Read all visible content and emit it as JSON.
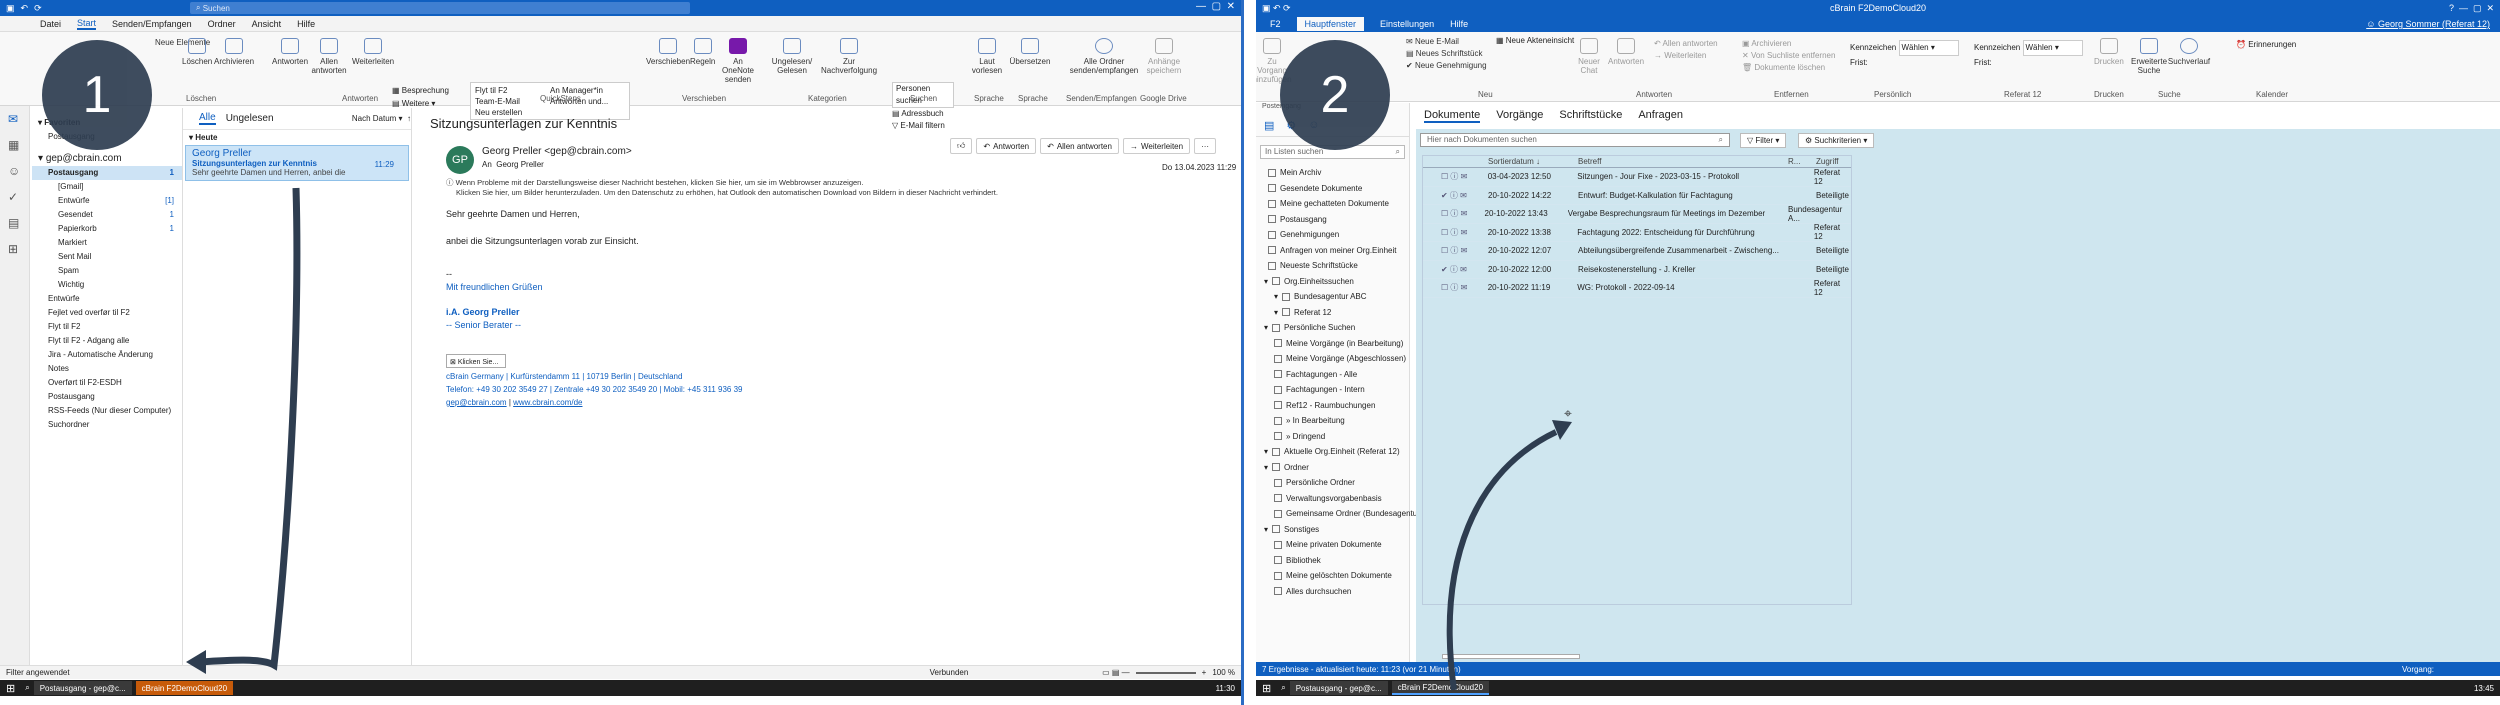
{
  "left": {
    "search_placeholder": "Suchen",
    "tabs": [
      "Datei",
      "Start",
      "Senden/Empfangen",
      "Ordner",
      "Ansicht",
      "Hilfe"
    ],
    "active_tab": "Start",
    "ribbon": {
      "new_buttons": [
        "Neue E-Mail",
        "Neue Elemente"
      ],
      "delete_group": {
        "label": "Löschen",
        "buttons": [
          "Löschen",
          "Archivieren"
        ]
      },
      "respond_group": {
        "label": "Antworten",
        "buttons": [
          "Antworten",
          "Allen antworten",
          "Weiterleiten"
        ],
        "small": [
          "Besprechung",
          "Weitere"
        ]
      },
      "quicksteps": {
        "label": "QuickSteps",
        "items": [
          "Flyt til F2",
          "Team-E-Mail",
          "Neu erstellen",
          "An Manager*in",
          "Antworten und..."
        ]
      },
      "move_group": {
        "label": "Verschieben",
        "buttons": [
          "Verschieben",
          "Regeln",
          "An OneNote senden"
        ]
      },
      "tags_group": {
        "label": "Kategorien",
        "buttons": [
          "Ungelesen/ Gelesen",
          "Zur Nachverfolgung"
        ]
      },
      "find_group": {
        "label": "Suchen",
        "items": [
          "Personen suchen",
          "Adressbuch",
          "E-Mail filtern"
        ]
      },
      "speech": {
        "label": "Sprache",
        "button": "Laut vorlesen"
      },
      "lang": {
        "label": "Sprache",
        "button": "Übersetzen"
      },
      "sendrecv": {
        "label": "Senden/Empfangen",
        "button": "Alle Ordner senden/empfangen"
      },
      "gdrive": {
        "label": "Google Drive",
        "button": "Anhänge speichern"
      }
    },
    "folders": {
      "favorites": [
        "Favoriten",
        "Postausgang"
      ],
      "account": "gep@cbrain.com",
      "items": [
        {
          "name": "Postausgang",
          "count": "1",
          "bold": true
        },
        {
          "name": "[Gmail]",
          "count": ""
        },
        {
          "name": "Entwürfe",
          "count": "[1]"
        },
        {
          "name": "Gesendet",
          "count": "1"
        },
        {
          "name": "Papierkorb",
          "count": "1"
        },
        {
          "name": "Markiert",
          "count": ""
        },
        {
          "name": "Sent Mail",
          "count": ""
        },
        {
          "name": "Spam",
          "count": ""
        },
        {
          "name": "Wichtig",
          "count": ""
        },
        {
          "name": "Entwürfe",
          "count": ""
        },
        {
          "name": "Fejlet ved overfør til F2",
          "count": ""
        },
        {
          "name": "Flyt til F2",
          "count": ""
        },
        {
          "name": "Flyt til F2 - Adgang alle",
          "count": ""
        },
        {
          "name": "Jira - Automatische Änderung",
          "count": ""
        },
        {
          "name": "Notes",
          "count": ""
        },
        {
          "name": "Overført til F2-ESDH",
          "count": ""
        },
        {
          "name": "Postausgang",
          "count": ""
        },
        {
          "name": "RSS-Feeds (Nur dieser Computer)",
          "count": ""
        },
        {
          "name": "Suchordner",
          "count": ""
        }
      ]
    },
    "list": {
      "filters": [
        "Alle",
        "Ungelesen"
      ],
      "sort": "Nach Datum",
      "group": "Heute",
      "mail": {
        "sender": "Georg Preller",
        "subject": "Sitzungsunterlagen zur Kenntnis",
        "preview": "Sehr geehrte Damen und Herren,  anbei die",
        "time": "11:29"
      }
    },
    "reading": {
      "title": "Sitzungsunterlagen zur Kenntnis",
      "avatar": "GP",
      "from": "Georg Preller <gep@cbrain.com>",
      "to": "Georg Preller",
      "to_label": "An",
      "date": "Do 13.04.2023 11:29",
      "actions": [
        "Antworten",
        "Allen antworten",
        "Weiterleiten"
      ],
      "info1": "Wenn Probleme mit der Darstellungsweise dieser Nachricht bestehen, klicken Sie hier, um sie im Webbrowser anzuzeigen.",
      "info2": "Klicken Sie hier, um Bilder herunterzuladen. Um den Datenschutz zu erhöhen, hat Outlook den automatischen Download von Bildern in dieser Nachricht verhindert.",
      "body1": "Sehr geehrte Damen und Herren,",
      "body2": "anbei die Sitzungsunterlagen vorab zur Einsicht.",
      "sig_dash": "--",
      "sig_greet": "Mit freundlichen Grüßen",
      "sig_name": "i.A. Georg Preller",
      "sig_role": "-- Senior Berater --",
      "img_alt": "Klicken Sie...",
      "addr1": "cBrain Germany | Kurfürstendamm 11 | 10719 Berlin | Deutschland",
      "addr2": "Telefon: +49 30 202 3549 27 | Zentrale +49 30 202 3549 20 | Mobil: +45 311 936 39",
      "addr3a": "gep@cbrain.com",
      "addr3b": "www.cbrain.com/de"
    },
    "status_left": "Filter angewendet",
    "status_mid": "Verbunden",
    "zoom": "100 %",
    "badge": "1",
    "taskbar": [
      "Postausgang - gep@c...",
      "cBrain F2DemoCloud20"
    ],
    "clock": "11:30"
  },
  "right": {
    "title": "cBrain F2DemoCloud20",
    "tabs": [
      "F2",
      "Hauptfenster",
      "Einstellungen",
      "Hilfe"
    ],
    "active_tab": "Hauptfenster",
    "user": "Georg Sommer (Referat 12)",
    "ribbon": {
      "new_items": [
        "Neue E-Mail",
        "Neues Schriftstück",
        "Neue Genehmigung",
        "Neue Akteneinsicht"
      ],
      "groups": [
        "Neu",
        "Antworten",
        "Entfernen",
        "Persönlich",
        "Referat 12",
        "Drucken",
        "Suche",
        "Kalender"
      ],
      "respond": [
        "Neuer Chat",
        "Antworten",
        "Allen antworten",
        "Weiterleiten"
      ],
      "remove": [
        "Archivieren",
        "Von Suchliste entfernen",
        "Dokumente löschen"
      ],
      "kennz1": "Kennzeichen",
      "kennz1v": "Wählen",
      "frist1": "Frist:",
      "kennz2": "Kennzeichen",
      "kennz2v": "Wählen",
      "frist2": "Frist:",
      "print": "Drucken",
      "search": [
        "Erweiterte Suche",
        "Suchverlauf"
      ],
      "calendar": "Erinnerungen",
      "left_btn": "Zu Vorgang hinzufügen"
    },
    "nav_search": "In Listen suchen",
    "nav_tab": "Posteingang",
    "nav": {
      "items1": [
        "Mein Archiv",
        "Gesendete Dokumente",
        "Meine gechatteten Dokumente",
        "Postausgang",
        "Genehmigungen",
        "Anfragen von meiner Org.Einheit",
        "Neueste Schriftstücke"
      ],
      "org_title": "Org.Einheitssuchen",
      "org": [
        "Bundesagentur ABC",
        "Referat 12"
      ],
      "personal_title": "Persönliche Suchen",
      "personal": [
        "Meine Vorgänge (in Bearbeitung)",
        "Meine Vorgänge (Abgeschlossen)",
        "Fachtagungen - Alle",
        "Fachtagungen - Intern",
        "Ref12 - Raumbuchungen",
        "» In Bearbeitung",
        "» Dringend"
      ],
      "current": "Aktuelle Org.Einheit (Referat 12)",
      "folders_title": "Ordner",
      "folders": [
        "Persönliche Ordner",
        "Verwaltungsvorgabenbasis",
        "Gemeinsame Ordner (Bundesagentur)"
      ],
      "other_title": "Sonstiges",
      "other": [
        "Meine privaten Dokumente",
        "Bibliothek",
        "Meine gelöschten Dokumente",
        "Alles durchsuchen"
      ]
    },
    "content_tabs": [
      "Dokumente",
      "Vorgänge",
      "Schriftstücke",
      "Anfragen"
    ],
    "search_placeholder": "Hier nach Dokumenten suchen",
    "filter": "Filter",
    "criteria": "Suchkriterien",
    "columns": [
      "Sortierdatum",
      "Betreff",
      "R...",
      "Zugriff"
    ],
    "rows": [
      {
        "date": "03-04-2023 12:50",
        "subject": "Sitzungen - Jour Fixe - 2023-03-15 - Protokoll",
        "access": "Referat 12"
      },
      {
        "date": "20-10-2022 14:22",
        "subject": "Entwurf: Budget-Kalkulation für Fachtagung",
        "access": "Beteiligte"
      },
      {
        "date": "20-10-2022 13:43",
        "subject": "Vergabe Besprechungsraum für Meetings im Dezember",
        "access": "Bundesagentur A..."
      },
      {
        "date": "20-10-2022 13:38",
        "subject": "Fachtagung 2022: Entscheidung für Durchführung",
        "access": "Referat 12"
      },
      {
        "date": "20-10-2022 12:07",
        "subject": "Abteilungsübergreifende Zusammenarbeit - Zwischeng...",
        "access": "Beteiligte"
      },
      {
        "date": "20-10-2022 12:00",
        "subject": "Reisekostenerstellung - J. Kreller",
        "access": "Beteiligte"
      },
      {
        "date": "20-10-2022 11:19",
        "subject": "WG: Protokoll - 2022-09-14",
        "access": "Referat 12"
      }
    ],
    "status": "7 Ergebnisse - aktualisiert heute: 11:23 (vor 21 Minuten)",
    "status_right": "Vorgang:",
    "badge": "2",
    "taskbar": [
      "Postausgang - gep@c...",
      "cBrain F2DemoCloud20"
    ],
    "clock": "13:45"
  }
}
